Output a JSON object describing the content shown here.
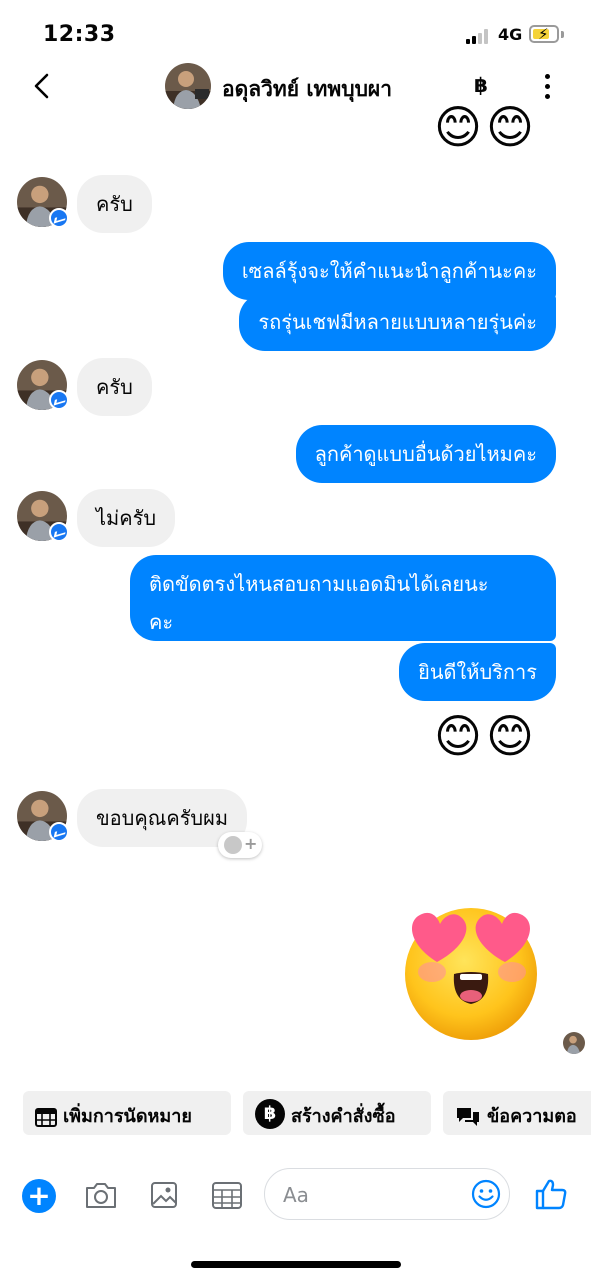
{
  "status_bar": {
    "time": "12:33",
    "network": "4G"
  },
  "header": {
    "contact_name": "อดุลวิทย์ เทพบุบผา",
    "back_icon": "chevron-left-icon",
    "baht_icon": "฿",
    "more_icon": "more-vertical-icon"
  },
  "messages": [
    {
      "from": "them",
      "text": "ครับ"
    },
    {
      "from": "me",
      "text": "เซลล์รุ้งจะให้คำแนะนำลูกค้านะคะ"
    },
    {
      "from": "me",
      "text": "รถรุ่นเชฟมีหลายแบบหลายรุ่นค่ะ"
    },
    {
      "from": "them",
      "text": "ครับ"
    },
    {
      "from": "me",
      "text": "ลูกค้าดูแบบอื่นด้วยไหมคะ"
    },
    {
      "from": "them",
      "text": "ไม่ครับ"
    },
    {
      "from": "me",
      "text_line1": "ติดขัดตรงไหนสอบถามแอดมินได้เลยนะ",
      "text_line2": "คะ"
    },
    {
      "from": "me",
      "text": "ยินดีให้บริการ"
    },
    {
      "from": "me",
      "emoji": "😊😊"
    },
    {
      "from": "them",
      "text": "ขอบคุณครับผม"
    },
    {
      "from": "me",
      "sticker": "heart-eyes-emoji"
    }
  ],
  "top_emoji": "😊😊",
  "quick_replies": [
    {
      "label": "เพิ่มการนัดหมาย",
      "icon": "calendar-icon"
    },
    {
      "label": "สร้างคำสั่งซื้อ",
      "icon": "baht-icon",
      "icon_text": "฿"
    },
    {
      "label": "ข้อความตอ",
      "icon": "chat-bubbles-icon"
    }
  ],
  "composer": {
    "placeholder": "Aa"
  },
  "colors": {
    "accent": "#0084ff",
    "incoming_bubble": "#f0f0f0"
  }
}
